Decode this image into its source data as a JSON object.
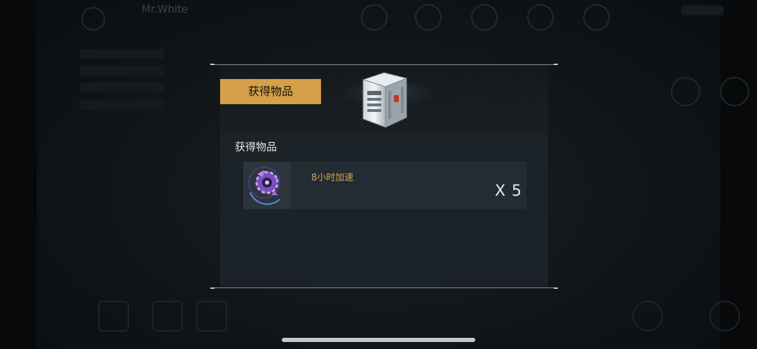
{
  "background": {
    "player_name": "Mr.White"
  },
  "dialog": {
    "header_title": "获得物品",
    "section_title": "获得物品",
    "items": [
      {
        "name": "8小时加速",
        "quantity": "X 5",
        "icon": "speedup-gear-icon"
      }
    ],
    "reward_icon": "supply-crate-icon"
  },
  "colors": {
    "accent_gold": "#d4a049",
    "item_name": "#d9a24c",
    "panel": "#1b2228"
  }
}
